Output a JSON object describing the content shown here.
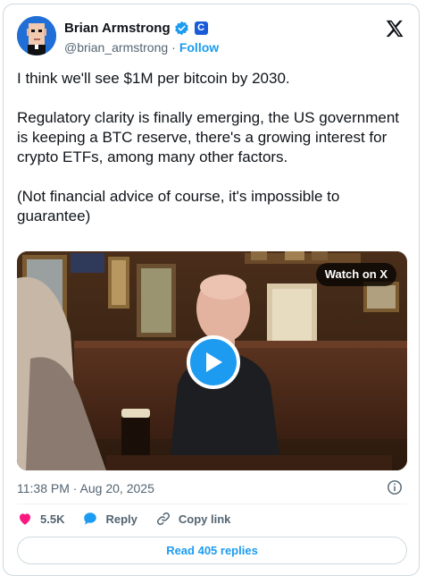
{
  "author": {
    "name": "Brian Armstrong",
    "handle": "@brian_armstrong",
    "separator": "·",
    "follow_label": "Follow",
    "affiliate_badge": "C",
    "avatar_icon": "pixel-avatar-icon",
    "verified_icon": "verified-badge-icon"
  },
  "tweet": {
    "paragraphs": [
      "I think we'll see $1M per bitcoin by 2030.",
      "Regulatory clarity is finally emerging, the US government is keeping a BTC reserve, there's a growing interest for crypto ETFs, among many other factors.",
      "(Not financial advice of course, it's impossible to guarantee)"
    ]
  },
  "media": {
    "watch_label": "Watch on X",
    "play_icon": "play-icon"
  },
  "meta": {
    "timestamp": "11:38 PM · Aug 20, 2025",
    "info_icon": "info-icon"
  },
  "actions": {
    "likes": "5.5K",
    "reply_label": "Reply",
    "copy_link_label": "Copy link"
  },
  "read_replies_label": "Read 405 replies",
  "colors": {
    "accent": "#1d9bf0",
    "like": "#f91880",
    "text": "#0f1419",
    "muted": "#536471"
  }
}
